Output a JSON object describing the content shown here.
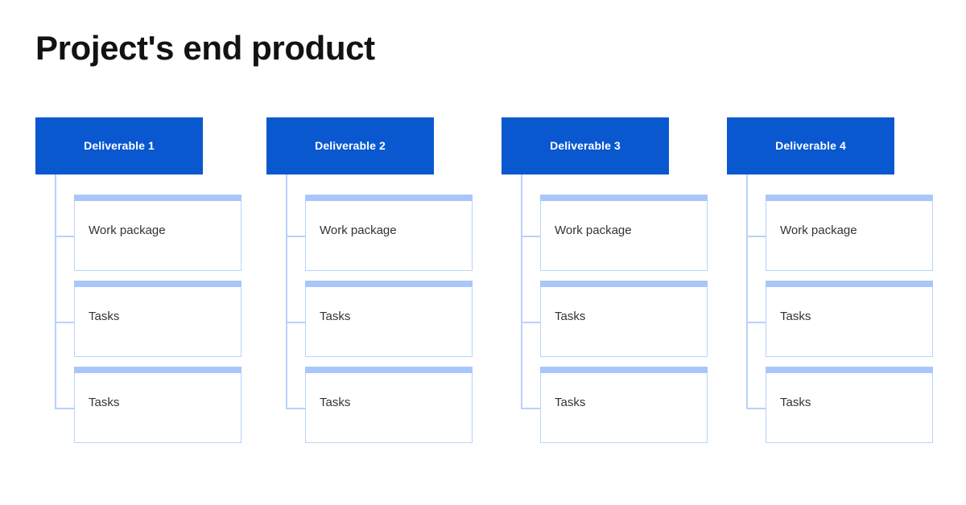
{
  "title": "Project's end product",
  "theme": {
    "background": "#ffffff",
    "header_blue": "#0a58d0",
    "header_text": "#ffffff",
    "card_topbar_blue": "#a8c6fa",
    "card_border_blue": "#b9d2fb",
    "connector_blue": "#b9d2fb",
    "card_text": "#333333",
    "title_text": "#121212"
  },
  "diagram": {
    "type": "work-breakdown-structure",
    "columns": [
      {
        "header": "Deliverable 1",
        "cards": [
          {
            "label": "Work package"
          },
          {
            "label": "Tasks"
          },
          {
            "label": "Tasks"
          }
        ]
      },
      {
        "header": "Deliverable 2",
        "cards": [
          {
            "label": "Work package"
          },
          {
            "label": "Tasks"
          },
          {
            "label": "Tasks"
          }
        ]
      },
      {
        "header": "Deliverable 3",
        "cards": [
          {
            "label": "Work package"
          },
          {
            "label": "Tasks"
          },
          {
            "label": "Tasks"
          }
        ]
      },
      {
        "header": "Deliverable 4",
        "cards": [
          {
            "label": "Work package"
          },
          {
            "label": "Tasks"
          },
          {
            "label": "Tasks"
          }
        ]
      }
    ]
  }
}
